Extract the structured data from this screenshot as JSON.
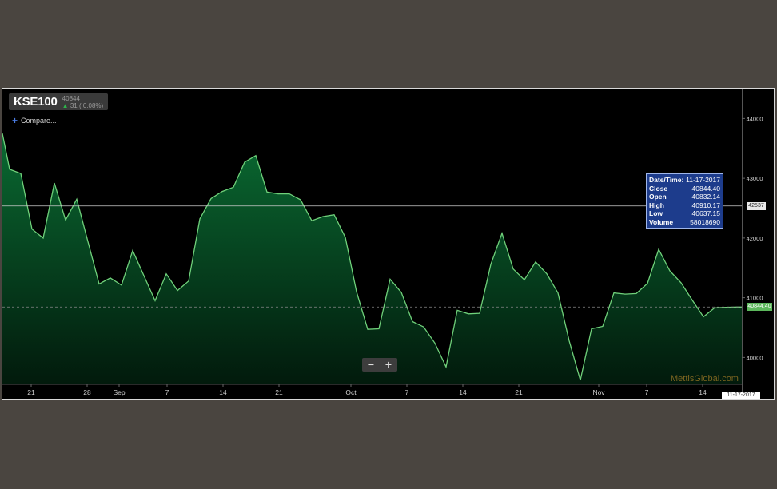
{
  "header": {
    "ticker": "KSE100",
    "last_value": "40844",
    "change_text": "31 ( 0.08%)",
    "compare_label": "Compare..."
  },
  "tooltip": {
    "rows": [
      {
        "label": "Date/Time:",
        "value": "11-17-2017"
      },
      {
        "label": "Close",
        "value": "40844.40"
      },
      {
        "label": "Open",
        "value": "40832.14"
      },
      {
        "label": "High",
        "value": "40910.17"
      },
      {
        "label": "Low",
        "value": "40637.15"
      },
      {
        "label": "Volume",
        "value": "58018690"
      }
    ]
  },
  "crosshair_label": "42537",
  "last_price_label": "40844.40",
  "current_date": "11-17-2017",
  "watermark": "MettisGlobal.com",
  "zoom": {
    "minus": "−",
    "plus": "+"
  },
  "colors": {
    "line": "#6fd07a",
    "fill_top": "#0a6a32",
    "fill_bottom": "#021a0c",
    "background": "#000000",
    "crosshair": "#cccccc",
    "last_price": "#5cb85c"
  },
  "chart_data": {
    "type": "area",
    "title": "",
    "xlabel": "",
    "ylabel": "",
    "y_ticks": [
      40000,
      41000,
      42000,
      43000,
      44000
    ],
    "ylim": [
      39550,
      44500
    ],
    "x_ticks": [
      {
        "label": "21",
        "day": 21
      },
      {
        "label": "28",
        "day": 28
      },
      {
        "label": "Sep",
        "day": 32
      },
      {
        "label": "7",
        "day": 38
      },
      {
        "label": "14",
        "day": 45
      },
      {
        "label": "21",
        "day": 52
      },
      {
        "label": "Oct",
        "day": 61
      },
      {
        "label": "7",
        "day": 68
      },
      {
        "label": "14",
        "day": 75
      },
      {
        "label": "21",
        "day": 82
      },
      {
        "label": "Nov",
        "day": 92
      },
      {
        "label": "7",
        "day": 98
      },
      {
        "label": "14",
        "day": 105
      }
    ],
    "xlim": [
      17.4,
      109.9
    ],
    "series": [
      {
        "x": [
          17.4,
          18.3,
          19.7,
          21.1,
          22.5,
          23.9,
          25.3,
          26.7,
          28.1,
          29.5,
          30.9,
          32.3,
          33.7,
          35.1,
          36.5,
          37.9,
          39.3,
          40.7,
          42.1,
          43.5,
          44.9,
          46.3,
          47.7,
          49.1,
          50.5,
          51.9,
          53.3,
          54.7,
          56.1,
          57.5,
          58.9,
          60.3,
          61.7,
          63.1,
          64.5,
          65.9,
          67.3,
          68.7,
          70.1,
          71.5,
          72.9,
          74.3,
          75.7,
          77.1,
          78.5,
          79.9,
          81.3,
          82.7,
          84.1,
          85.5,
          86.9,
          88.3,
          89.7,
          91.1,
          92.5,
          93.9,
          95.3,
          96.7,
          98.1,
          99.5,
          100.9,
          102.3,
          103.7,
          105.1,
          106.5,
          107.9,
          109.3,
          109.9
        ],
        "y": [
          43750,
          43150,
          43080,
          42150,
          42000,
          42920,
          42300,
          42650,
          41940,
          41230,
          41330,
          41210,
          41790,
          41370,
          40950,
          41400,
          41120,
          41280,
          42320,
          42660,
          42780,
          42850,
          43270,
          43380,
          42770,
          42740,
          42740,
          42640,
          42290,
          42360,
          42390,
          42010,
          41100,
          40470,
          40480,
          41310,
          41090,
          40600,
          40510,
          40240,
          39840,
          40790,
          40730,
          40740,
          41560,
          42080,
          41480,
          41300,
          41600,
          41400,
          41080,
          40280,
          39620,
          40480,
          40520,
          41080,
          41060,
          41070,
          41240,
          41810,
          41450,
          41250,
          40960,
          40680,
          40830,
          40840,
          40844,
          40844
        ]
      }
    ]
  }
}
